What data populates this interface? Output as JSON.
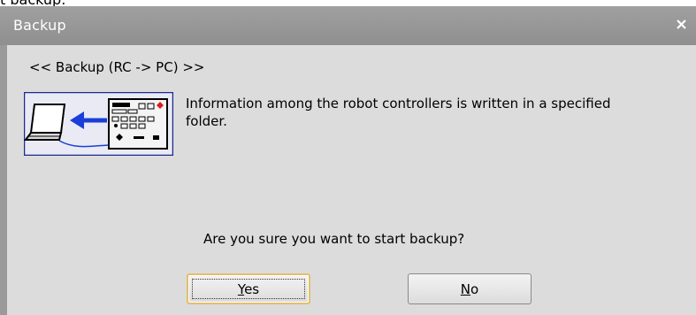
{
  "context_fragment": "t backup.",
  "window": {
    "title": "Backup",
    "close_glyph": "x"
  },
  "content": {
    "heading": "<< Backup (RC -> PC) >>",
    "info": "Information among the robot controllers is written in a specified folder.",
    "question": "Are you sure you want to start backup?",
    "illustration_icon": "controller-to-laptop-backup-icon"
  },
  "buttons": {
    "yes": {
      "mnemonic": "Y",
      "rest": "es"
    },
    "no": {
      "mnemonic": "N",
      "rest": "o"
    }
  },
  "colors": {
    "titlebar": "#999999",
    "dialog_bg": "#dcdcdc",
    "focus_border": "#e2c06a",
    "arrow_blue": "#1a3fd8",
    "illustration_border": "#1b2a8c"
  }
}
